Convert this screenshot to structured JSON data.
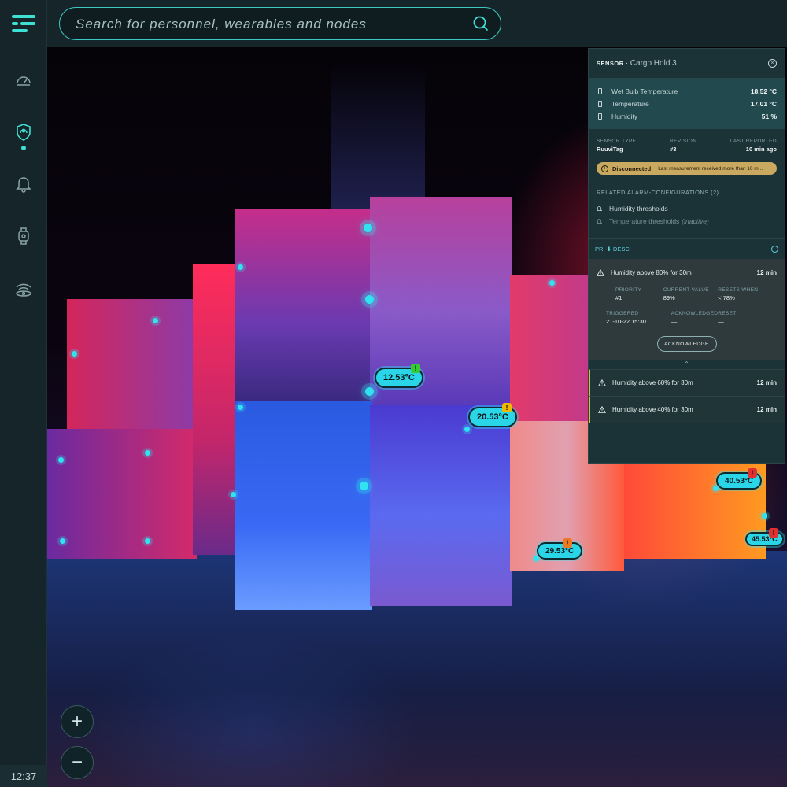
{
  "sidebar": {
    "items": [
      {
        "icon": "dashboard-icon"
      },
      {
        "icon": "shield-icon",
        "active": true
      },
      {
        "icon": "bell-icon"
      },
      {
        "icon": "watch-icon"
      },
      {
        "icon": "wireless-icon"
      }
    ],
    "clock": "12:37"
  },
  "search": {
    "placeholder": "Search for personnel, wearables and nodes"
  },
  "scene": {
    "temperature_labels": [
      {
        "value": "12.53°C",
        "alert": "!",
        "alert_color": "#33cc33"
      },
      {
        "value": "20.53°C",
        "alert": "!",
        "alert_color": "#f0b800"
      },
      {
        "value": "40.53°C",
        "alert": "!",
        "alert_color": "#e23030"
      },
      {
        "value": "29.53°C",
        "alert": "!",
        "alert_color": "#f07820"
      },
      {
        "value": "45.53°C",
        "alert": "!",
        "alert_color": "#e23030"
      }
    ]
  },
  "zoom": {
    "in": "+",
    "out": "−"
  },
  "panel": {
    "kind": "SENSOR",
    "name": "· Cargo Hold 3",
    "close": "×",
    "readings": [
      {
        "label": "Wet Bulb Temperature",
        "value": "18,52 °C"
      },
      {
        "label": "Temperature",
        "value": "17,01 °C"
      },
      {
        "label": "Humidity",
        "value": "51 %"
      }
    ],
    "meta": {
      "sensor_type_label": "SENSOR TYPE",
      "sensor_type": "RuuviTag",
      "revision_label": "REVISION",
      "revision": "#3",
      "last_reported_label": "LAST REPORTED",
      "last_reported": "10 min ago"
    },
    "status": {
      "icon": "i",
      "label": "Disconnected",
      "message": "Last measurement received more than 10 m..."
    },
    "related_header": "RELATED ALARM-CONFIGURATIONS (2)",
    "related": [
      {
        "label": "Humidity thresholds",
        "active": true
      },
      {
        "label": "Temperature thresholds",
        "suffix": "(inactive)",
        "active": false
      }
    ],
    "sort": {
      "label": "PRI ⬇ DESC"
    },
    "alarms": [
      {
        "title": "Humidity above 80% for 30m",
        "duration": "12 min",
        "expanded": true,
        "priority_label": "PRIORITY",
        "priority": "#1",
        "current_label": "CURRENT VALUE",
        "current": "89%",
        "resets_label": "RESETS WHEN",
        "resets": "< 78%",
        "triggered_label": "TRIGGERED",
        "triggered": "21-10-22 15:30",
        "ack_label": "ACKNOWLEDGED",
        "ack": "—",
        "reset_label": "RESET",
        "reset": "—",
        "action": "ACKNOWLEDGE"
      },
      {
        "title": "Humidity above 60% for 30m",
        "duration": "12 min"
      },
      {
        "title": "Humidity above 40% for 30m",
        "duration": "12 min"
      }
    ],
    "caret": "⌃"
  },
  "colors": {
    "accent": "#3ee0d4",
    "warning": "#f0b33b",
    "status_bg": "#c9a860"
  }
}
